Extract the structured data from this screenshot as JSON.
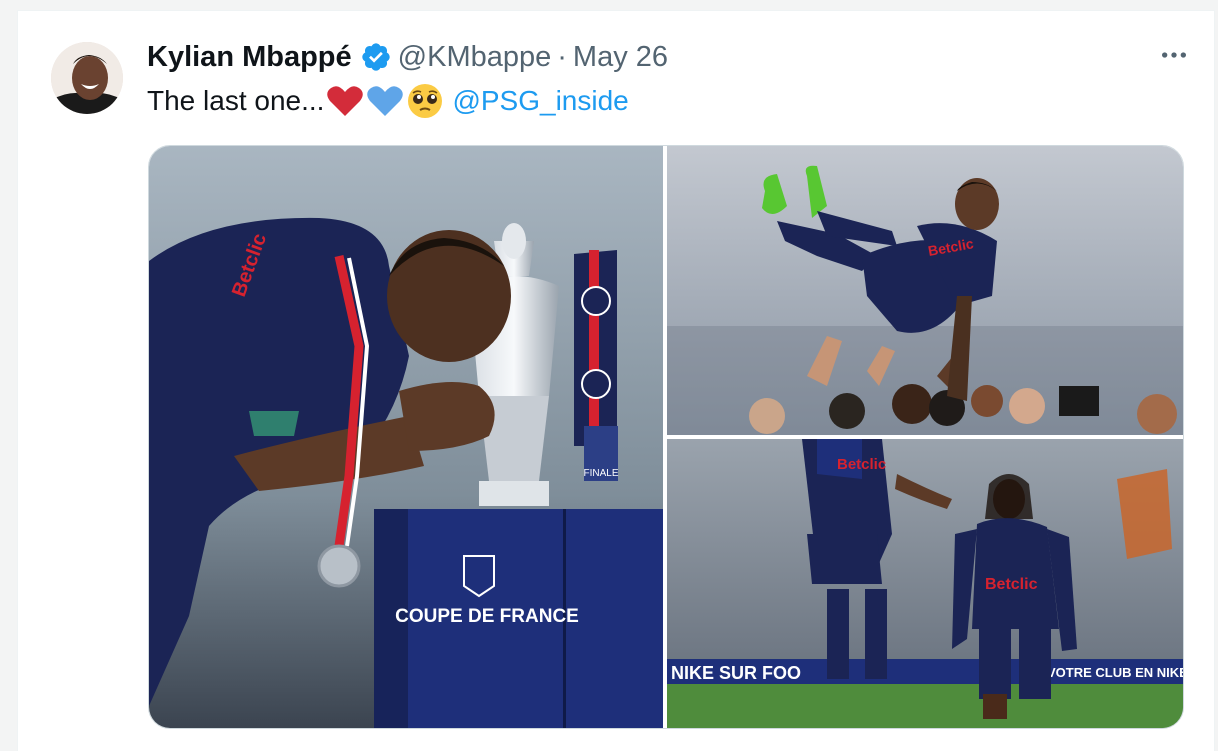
{
  "tweet": {
    "author": {
      "name": "Kylian Mbappé",
      "handle": "@KMbappe",
      "verified": true
    },
    "separator": "·",
    "date": "May 26",
    "text": "The last one...",
    "emojis": [
      "red-heart-emoji",
      "blue-heart-emoji",
      "pleading-face-emoji"
    ],
    "mention": "@PSG_inside",
    "more_icon": "more-horizontal-icon"
  },
  "media": {
    "photo_1": {
      "trophy_label": "COUPE DE FRANCE",
      "ribbon_label": "FINALE",
      "sponsor_text": "Betclic"
    },
    "photo_3": {
      "sponsor_text": "Betclic",
      "board_left": "NIKE SUR FOO",
      "board_right": "VOTRE CLUB EN NIKE"
    }
  },
  "colors": {
    "verified": "#1d9bf0",
    "link": "#1d9bf0",
    "text_primary": "#0f1419",
    "text_secondary": "#536471",
    "psg_navy": "#1b2455",
    "psg_red": "#d6222f"
  }
}
